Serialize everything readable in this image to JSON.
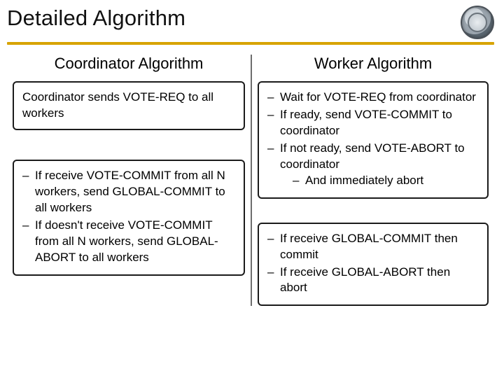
{
  "title": "Detailed Algorithm",
  "seal_alt": "institution-seal",
  "left": {
    "heading": "Coordinator Algorithm",
    "box1": {
      "plain": "Coordinator sends VOTE-REQ to all workers"
    },
    "box2": {
      "items": [
        "If receive VOTE-COMMIT from all N workers, send GLOBAL-COMMIT to all workers",
        "If doesn't receive VOTE-COMMIT from all N workers, send GLOBAL-ABORT to all workers"
      ]
    }
  },
  "right": {
    "heading": "Worker Algorithm",
    "box1": {
      "items": [
        "Wait for VOTE-REQ from coordinator",
        "If ready, send VOTE-COMMIT to coordinator",
        "If not ready, send VOTE-ABORT to coordinator"
      ],
      "nested": [
        "And immediately abort"
      ]
    },
    "box2": {
      "items": [
        "If receive GLOBAL-COMMIT then commit",
        "If receive GLOBAL-ABORT then abort"
      ]
    }
  }
}
